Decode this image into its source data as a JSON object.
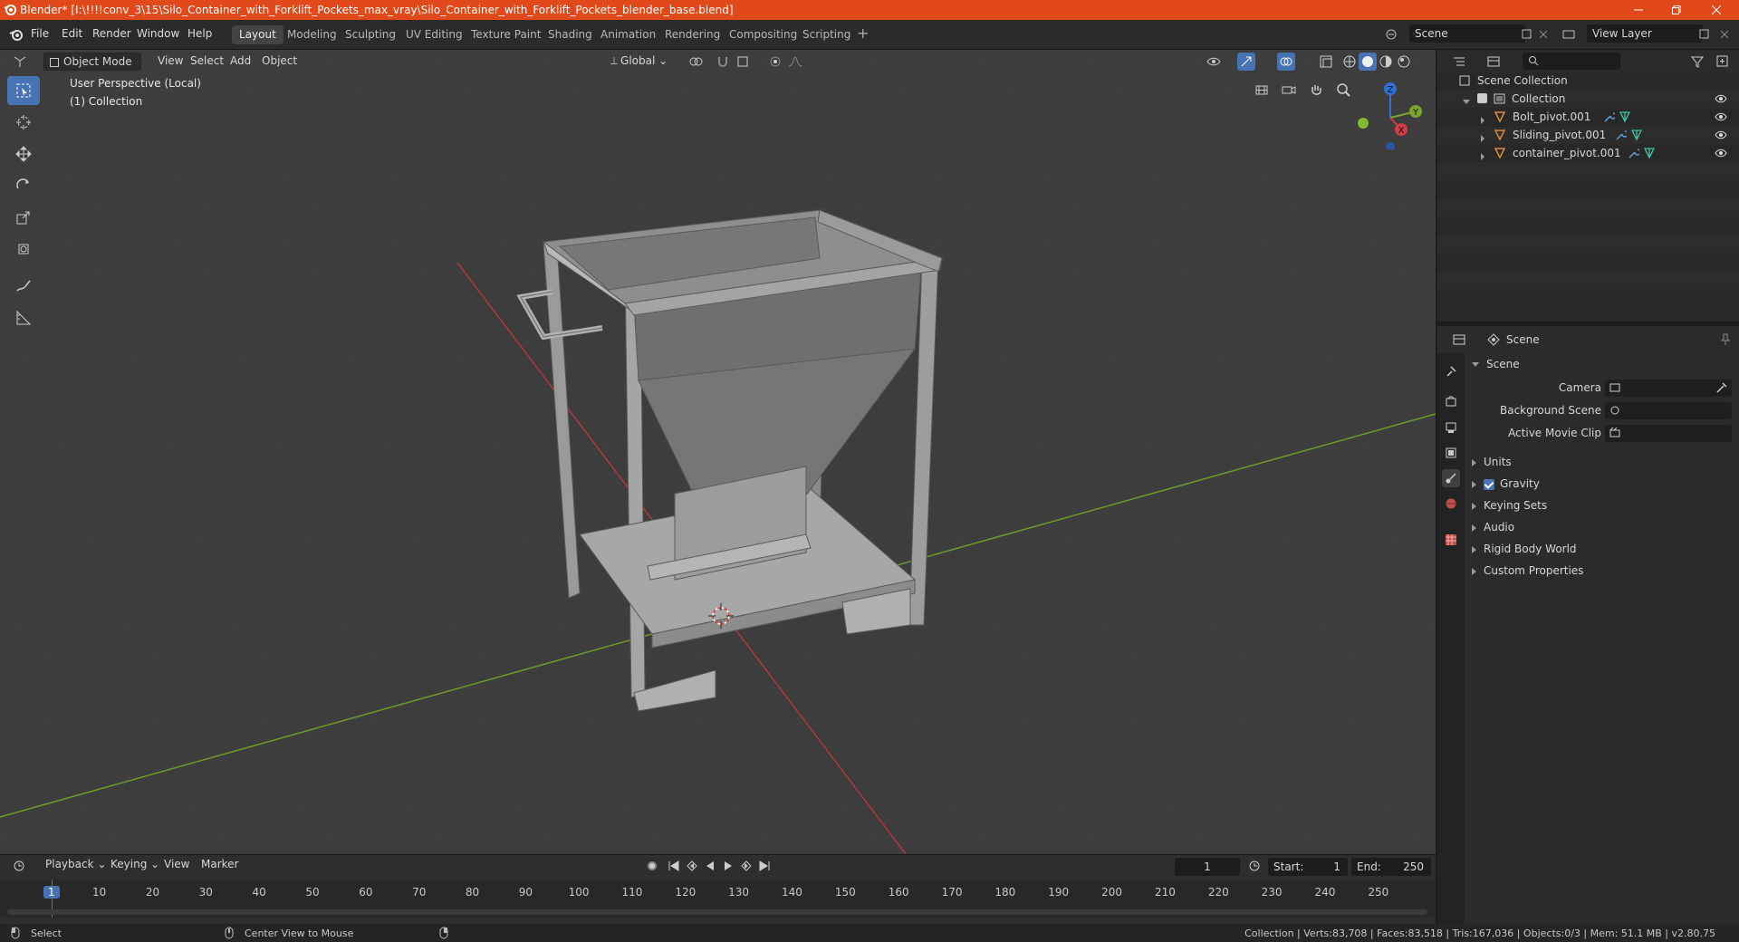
{
  "titlebar": {
    "title": "Blender* [I:\\!!!!conv_3\\15\\Silo_Container_with_Forklift_Pockets_max_vray\\Silo_Container_with_Forklift_Pockets_blender_base.blend]"
  },
  "menubar": {
    "items": [
      "File",
      "Edit",
      "Render",
      "Window",
      "Help"
    ]
  },
  "workspaces": [
    "Layout",
    "Modeling",
    "Sculpting",
    "UV Editing",
    "Texture Paint",
    "Shading",
    "Animation",
    "Rendering",
    "Compositing",
    "Scripting"
  ],
  "scene_field": "Scene",
  "view_layer_field": "View Layer",
  "viewport_header": {
    "mode": "Object Mode",
    "menus": [
      "View",
      "Select",
      "Add",
      "Object"
    ],
    "transform": "Global"
  },
  "viewport": {
    "perspective": "User Perspective (Local)",
    "collection": "(1) Collection"
  },
  "gizmo": {
    "z": "Z",
    "y": "Y",
    "x": "X"
  },
  "outliner": {
    "root": "Scene Collection",
    "collection": "Collection",
    "objects": [
      "Bolt_pivot.001",
      "Sliding_pivot.001",
      "container_pivot.001"
    ]
  },
  "properties": {
    "header": "Scene",
    "section": "Scene",
    "fields": [
      {
        "label": "Camera"
      },
      {
        "label": "Background Scene"
      },
      {
        "label": "Active Movie Clip"
      }
    ],
    "panels": [
      "Units",
      "Gravity",
      "Keying Sets",
      "Audio",
      "Rigid Body World",
      "Custom Properties"
    ]
  },
  "timeline": {
    "menus": [
      "Playback",
      "Keying",
      "View",
      "Marker"
    ],
    "current_frame": "1",
    "start_label": "Start:",
    "start": "1",
    "end_label": "End:",
    "end": "250",
    "ticks": [
      "1",
      "10",
      "20",
      "30",
      "40",
      "50",
      "60",
      "70",
      "80",
      "90",
      "100",
      "110",
      "120",
      "130",
      "140",
      "150",
      "160",
      "170",
      "180",
      "190",
      "200",
      "210",
      "220",
      "230",
      "240",
      "250"
    ]
  },
  "statusbar": {
    "left": "Select",
    "middle": "Center View to Mouse",
    "right": "Collection | Verts:83,708 | Faces:83,518 | Tris:167,036 | Objects:0/3 | Mem: 51.1 MB | v2.80.75"
  },
  "colors": {
    "accent": "#4772b3",
    "titlebar": "#e2491a",
    "x_axis": "#b8333d",
    "y_axis": "#6f9a2a"
  }
}
